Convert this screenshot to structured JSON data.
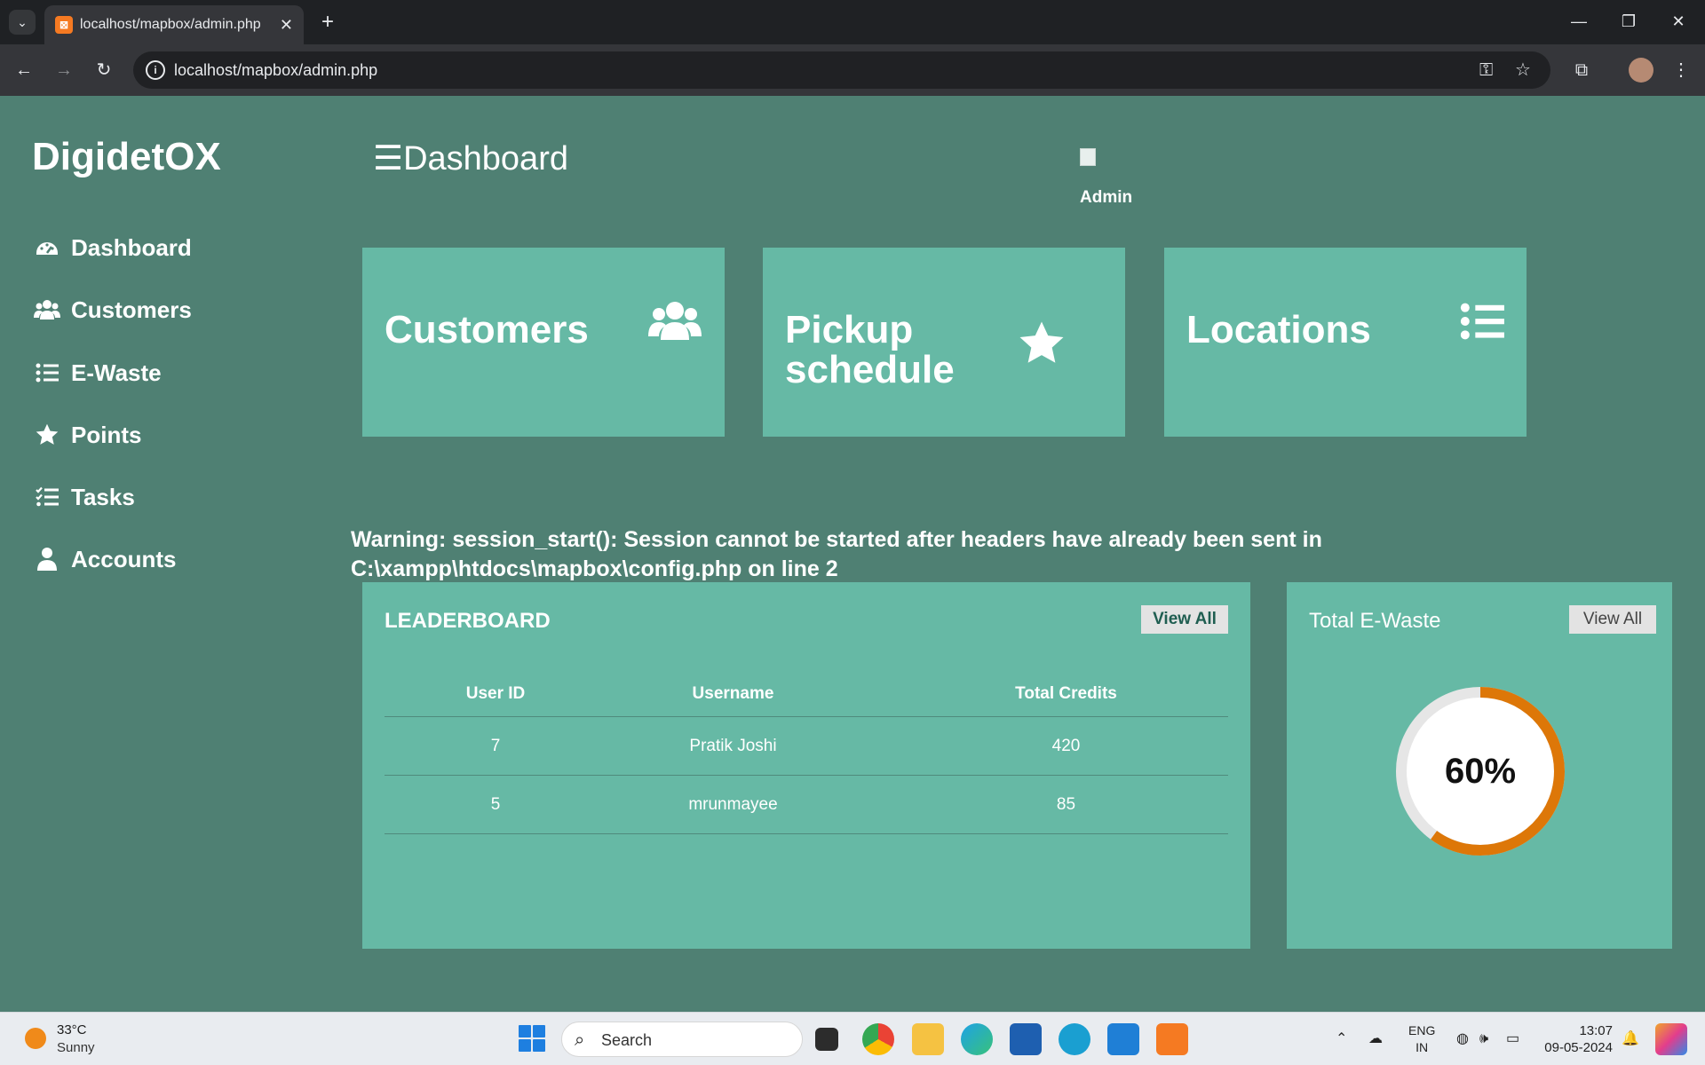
{
  "browser": {
    "tab_title": "localhost/mapbox/admin.php",
    "tab_close": "✕",
    "new_tab": "+",
    "url": "localhost/mapbox/admin.php",
    "minimize": "—",
    "restore": "❐",
    "close": "✕"
  },
  "sidebar": {
    "brand": "DigidetOX",
    "items": [
      {
        "label": "Dashboard",
        "icon": "gauge-icon"
      },
      {
        "label": "Customers",
        "icon": "users-icon"
      },
      {
        "label": "E-Waste",
        "icon": "list-icon"
      },
      {
        "label": "Points",
        "icon": "star-icon"
      },
      {
        "label": "Tasks",
        "icon": "tasks-icon"
      },
      {
        "label": "Accounts",
        "icon": "user-icon"
      }
    ]
  },
  "header": {
    "menu_glyph": "☰",
    "title": "Dashboard",
    "user_name": "Admin"
  },
  "cards": [
    {
      "title": "Customers",
      "icon": "users-icon"
    },
    {
      "title": "Pickup schedule",
      "title_line1": "Pickup",
      "title_line2": "schedule",
      "icon": "star-icon"
    },
    {
      "title": "Locations",
      "icon": "list-icon"
    }
  ],
  "warning": {
    "line1": "Warning: session_start(): Session cannot be started after headers have already been sent in",
    "line2": "C:\\xampp\\htdocs\\mapbox\\config.php on line 2"
  },
  "leaderboard": {
    "title": "LEADERBOARD",
    "view_all": "View All",
    "columns": [
      "User ID",
      "Username",
      "Total Credits"
    ],
    "rows": [
      {
        "user_id": "7",
        "username": "Pratik Joshi",
        "credits": "420"
      },
      {
        "user_id": "5",
        "username": "mrunmayee",
        "credits": "85"
      }
    ]
  },
  "total_ewaste": {
    "title": "Total E-Waste",
    "view_all": "View All",
    "percent_label": "60%",
    "percent_value": 60,
    "accent_color": "#dd7708",
    "track_color": "#e6e6e6"
  },
  "taskbar": {
    "weather_temp": "33°C",
    "weather_cond": "Sunny",
    "search_placeholder": "Search",
    "lang_line1": "ENG",
    "lang_line2": "IN",
    "time": "13:07",
    "date": "09-05-2024"
  },
  "colors": {
    "page_bg": "#4f8073",
    "card_bg": "#66b9a5",
    "text": "#ffffff"
  }
}
